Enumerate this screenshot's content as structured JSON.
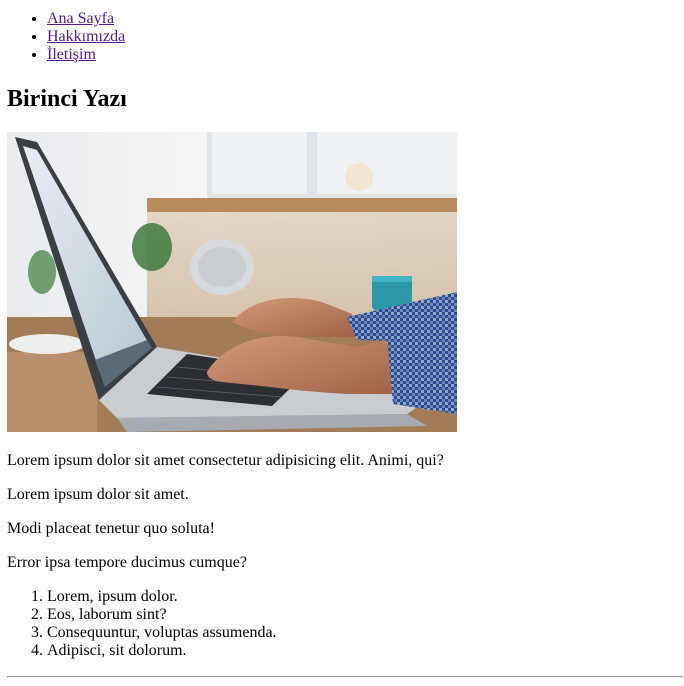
{
  "nav": {
    "items": [
      {
        "label": "Ana Sayfa"
      },
      {
        "label": "Hakkımızda"
      },
      {
        "label": "İletişim"
      }
    ]
  },
  "article": {
    "title": "Birinci Yazı",
    "paragraphs": [
      "Lorem ipsum dolor sit amet consectetur adipisicing elit. Animi, qui?",
      "Lorem ipsum dolor sit amet.",
      "Modi placeat tenetur quo soluta!",
      "Error ipsa tempore ducimus cumque?"
    ],
    "list": [
      "Lorem, ipsum dolor.",
      "Eos, laborum sint?",
      "Consequuntur, voluptas assumenda.",
      "Adipisci, sit dolorum."
    ]
  },
  "colors": {
    "link_visited": "#551a8b",
    "text": "#000000",
    "background": "#ffffff"
  }
}
